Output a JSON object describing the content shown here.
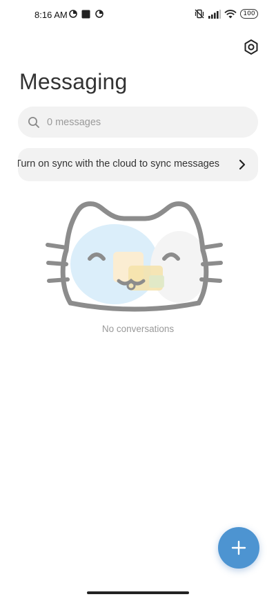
{
  "status_bar": {
    "time": "8:16 AM",
    "battery_level": "100",
    "icons": [
      "data-saver-icon",
      "stop-square-icon",
      "data-saver-icon",
      "vibrate-off-icon",
      "signal-icon",
      "wifi-icon",
      "battery-icon"
    ]
  },
  "header": {
    "title": "Messaging",
    "settings_icon": "settings-icon"
  },
  "search": {
    "placeholder": "0 messages",
    "icon": "search-icon"
  },
  "sync_banner": {
    "text": "Turn on sync with the cloud to sync messages",
    "icon": "chevron-right-icon"
  },
  "empty_state": {
    "label": "No conversations",
    "illustration": "cat-face-illustration"
  },
  "fab": {
    "icon": "plus-icon",
    "color": "#4d94d1"
  },
  "colors": {
    "background": "#ffffff",
    "field_background": "#f2f2f2",
    "accent": "#4d94d1"
  }
}
